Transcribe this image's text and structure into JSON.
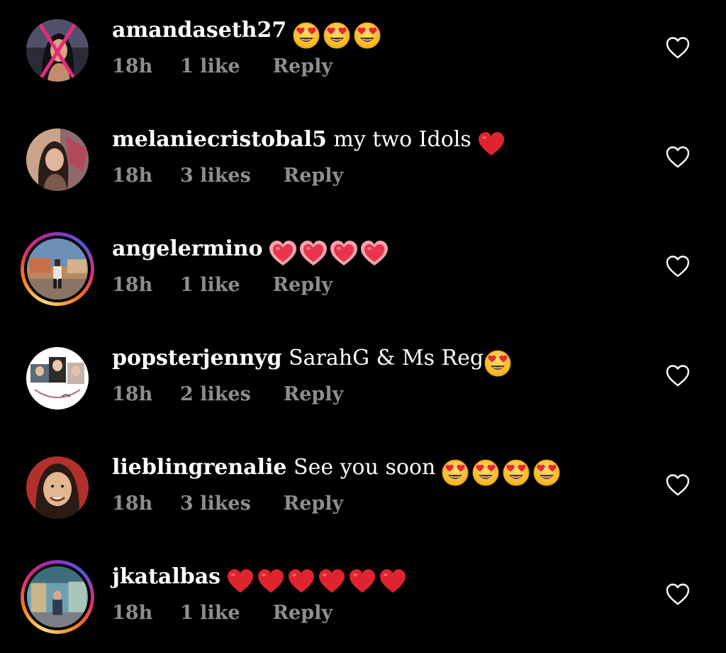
{
  "comments": [
    {
      "username": "amandaseth27",
      "text": "",
      "emojis": [
        "heart-eyes",
        "heart-eyes",
        "heart-eyes"
      ],
      "time": "18h",
      "likes": "1 like",
      "reply": "Reply"
    },
    {
      "username": "melaniecristobal5",
      "text": "my two Idols",
      "emojis": [
        "red-heart"
      ],
      "time": "18h",
      "likes": "3 likes",
      "reply": "Reply"
    },
    {
      "username": "angelermino",
      "text": "",
      "emojis": [
        "pink-heart",
        "pink-heart",
        "pink-heart",
        "pink-heart"
      ],
      "time": "18h",
      "likes": "1 like",
      "reply": "Reply"
    },
    {
      "username": "popsterjennyg",
      "text": "SarahG & Ms Reg",
      "emojis": [
        "heart-eyes"
      ],
      "time": "18h",
      "likes": "2 likes",
      "reply": "Reply"
    },
    {
      "username": "lieblingrenalie",
      "text": "See you soon",
      "emojis": [
        "heart-eyes",
        "heart-eyes",
        "heart-eyes",
        "heart-eyes"
      ],
      "time": "18h",
      "likes": "3 likes",
      "reply": "Reply"
    },
    {
      "username": "jkatalbas",
      "text": "",
      "emojis": [
        "red-heart",
        "red-heart",
        "red-heart",
        "red-heart",
        "red-heart",
        "red-heart"
      ],
      "time": "18h",
      "likes": "1 like",
      "reply": "Reply"
    }
  ],
  "icons": {
    "like": "heart-outline-icon"
  },
  "colors": {
    "background": "#000000",
    "text": "#ffffff",
    "meta": "#8e8e8e"
  }
}
